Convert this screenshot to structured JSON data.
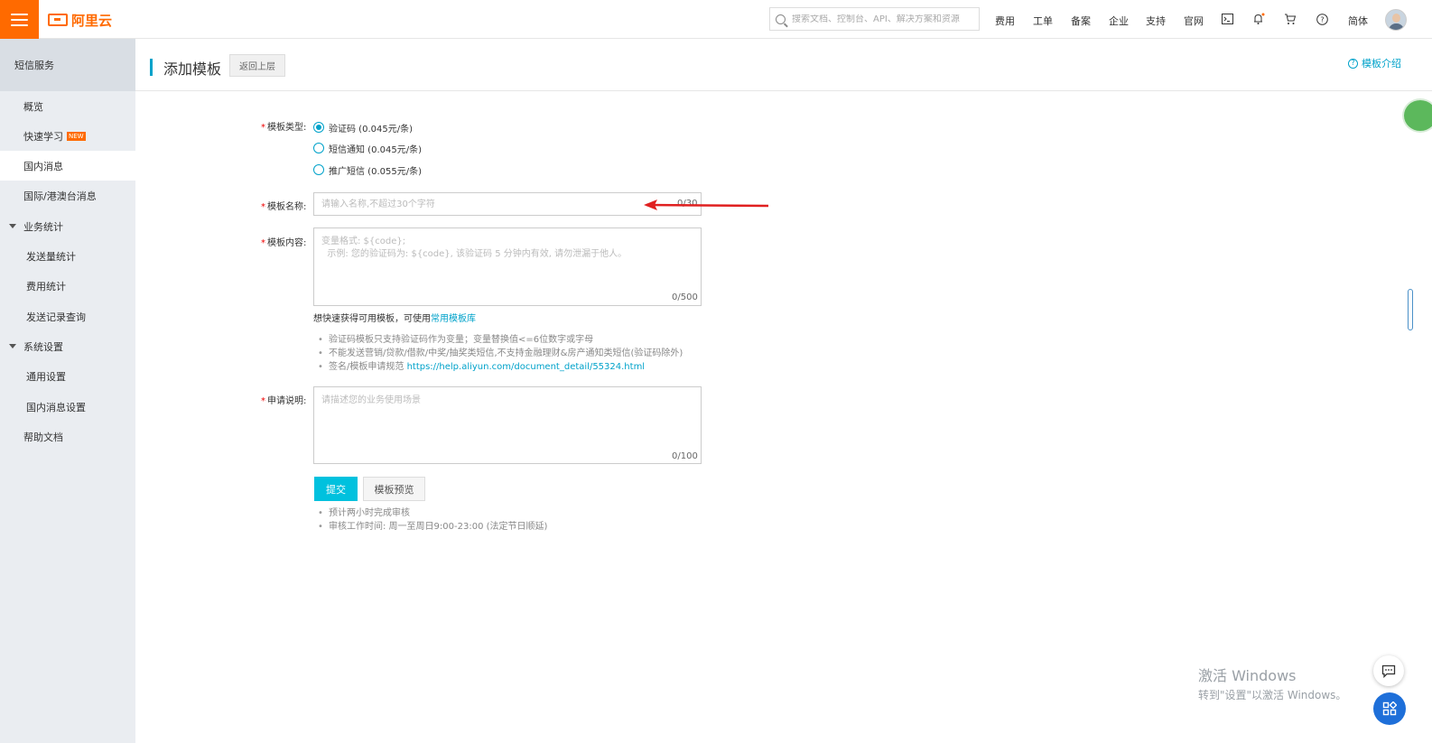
{
  "topbar": {
    "brand": "阿里云",
    "search_placeholder": "搜索文档、控制台、API、解决方案和资源",
    "nav": [
      "费用",
      "工单",
      "备案",
      "企业",
      "支持",
      "官网"
    ],
    "lang": "简体"
  },
  "sidebar": {
    "header": "短信服务",
    "items": [
      {
        "label": "概览"
      },
      {
        "label": "快速学习",
        "badge": "NEW"
      },
      {
        "label": "国内消息"
      },
      {
        "label": "国际/港澳台消息"
      },
      {
        "label": "业务统计"
      },
      {
        "label": "发送量统计"
      },
      {
        "label": "费用统计"
      },
      {
        "label": "发送记录查询"
      },
      {
        "label": "系统设置"
      },
      {
        "label": "通用设置"
      },
      {
        "label": "国内消息设置"
      },
      {
        "label": "帮助文档"
      }
    ]
  },
  "header": {
    "title": "添加模板",
    "back": "返回上层",
    "intro": "模板介绍"
  },
  "form": {
    "type_label": "模板类型:",
    "type_options": [
      {
        "label": "验证码 (0.045元/条)",
        "checked": true
      },
      {
        "label": "短信通知 (0.045元/条)",
        "checked": false
      },
      {
        "label": "推广短信 (0.055元/条)",
        "checked": false
      }
    ],
    "name_label": "模板名称:",
    "name_placeholder": "请输入名称,不超过30个字符",
    "name_counter": "0/30",
    "content_label": "模板内容:",
    "content_placeholder": "变量格式: ${code};\n  示例: 您的验证码为: ${code}, 该验证码 5 分钟内有效, 请勿泄漏于他人。",
    "content_counter": "0/500",
    "quick_hint": "想快速获得可用模板，可使用",
    "quick_link": "常用模板库",
    "tips": [
      "验证码模板只支持验证码作为变量；变量替换值<=6位数字或字母",
      "不能发送营销/贷款/借款/中奖/抽奖类短信,不支持金融理财&房产通知类短信(验证码除外)",
      "签名/模板申请规范"
    ],
    "tips_link": "https://help.aliyun.com/document_detail/55324.html",
    "reason_label": "申请说明:",
    "reason_placeholder": "请描述您的业务使用场景",
    "reason_counter": "0/100",
    "submit": "提交",
    "preview": "模板预览",
    "review_notes": [
      "预计两小时完成审核",
      "审核工作时间: 周一至周日9:00-23:00 (法定节日顺延)"
    ]
  },
  "watermark": {
    "line1": "激活 Windows",
    "line2": "转到\"设置\"以激活 Windows。"
  },
  "colors": {
    "brand_orange": "#ff6a00",
    "accent_blue": "#00a2ca",
    "submit_cyan": "#00c1de",
    "arrow_red": "#e02020"
  }
}
